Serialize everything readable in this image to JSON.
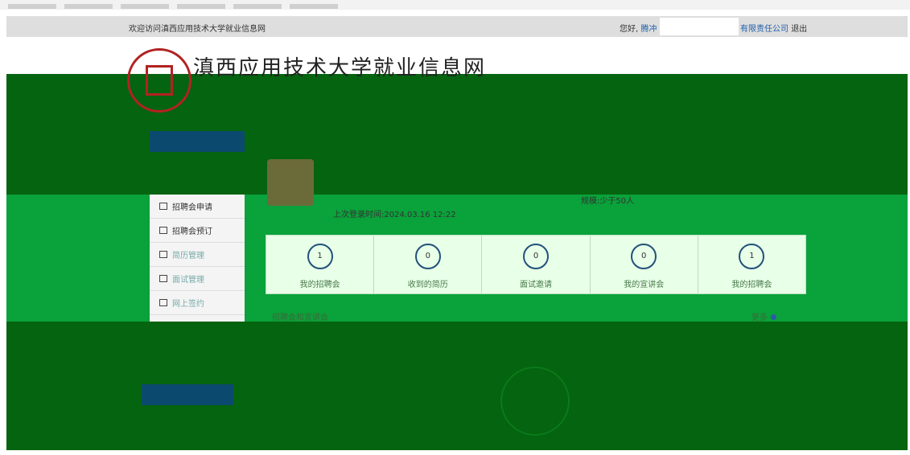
{
  "topbar": {
    "welcome": "欢迎访问滇西应用技术大学就业信息网",
    "greeting": "您好,",
    "user_name": "腾冲",
    "company_tail": "有限责任公司",
    "logout": "退出"
  },
  "header": {
    "brand": "滇西应用技术大学就业信息网"
  },
  "sidebar": {
    "items": [
      {
        "label": "招聘会申请"
      },
      {
        "label": "招聘会预订"
      },
      {
        "label": "简历管理"
      },
      {
        "label": "面试管理"
      },
      {
        "label": "网上签约"
      }
    ]
  },
  "profile": {
    "last_login": "上次登录时间:2024.03.16 12:22",
    "scale": "规模:少于50人"
  },
  "stats": [
    {
      "value": "1",
      "label": "我的招聘会"
    },
    {
      "value": "0",
      "label": "收到的简历"
    },
    {
      "value": "0",
      "label": "面试邀请"
    },
    {
      "value": "0",
      "label": "我的宣讲会"
    },
    {
      "value": "1",
      "label": "我的招聘会"
    }
  ],
  "section": {
    "title": "招聘会和宣讲会",
    "more": "更多"
  }
}
